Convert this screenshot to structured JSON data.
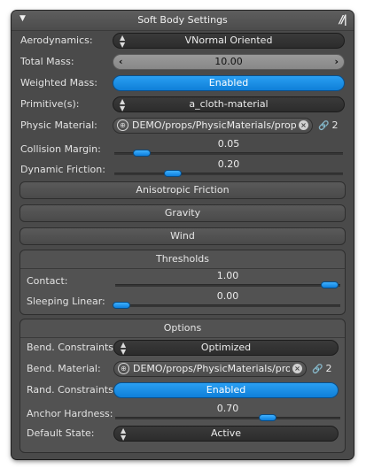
{
  "panel": {
    "title": "Soft Body Settings"
  },
  "rows": {
    "aerodynamics": {
      "label": "Aerodynamics:",
      "value": "VNormal Oriented"
    },
    "total_mass": {
      "label": "Total Mass:",
      "value": "10.00"
    },
    "weighted_mass": {
      "label": "Weighted Mass:",
      "value": "Enabled"
    },
    "primitives": {
      "label": "Primitive(s):",
      "value": "a_cloth-material"
    },
    "physic_material": {
      "label": "Physic Material:",
      "value": "DEMO/props/PhysicMaterials/prop_cl",
      "count": "2"
    },
    "collision_margin": {
      "label": "Collision Margin:",
      "value": "0.05",
      "level": 0.05
    },
    "dynamic_friction": {
      "label": "Dynamic Friction:",
      "value": "0.20",
      "level": 0.2
    }
  },
  "sections": {
    "anisotropic": "Anisotropic Friction",
    "gravity": "Gravity",
    "wind": "Wind"
  },
  "thresholds": {
    "title": "Thresholds",
    "contact": {
      "label": "Contact:",
      "value": "1.00",
      "level": 1.0
    },
    "sleeping_linear": {
      "label": "Sleeping Linear:",
      "value": "0.00",
      "level": 0.0
    }
  },
  "options": {
    "title": "Options",
    "bend_constraints": {
      "label": "Bend. Constraints:",
      "value": "Optimized"
    },
    "bend_material": {
      "label": "Bend. Material:",
      "value": "DEMO/props/PhysicMaterials/prop_",
      "count": "2"
    },
    "rand_constraints": {
      "label": "Rand. Constraints:",
      "value": "Enabled"
    },
    "anchor_hardness": {
      "label": "Anchor Hardness:",
      "value": "0.70",
      "level": 0.7
    },
    "default_state": {
      "label": "Default State:",
      "value": "Active"
    }
  },
  "colors": {
    "accent": "#1a8fe8",
    "panel": "#4a4a4a",
    "field": "#2f2f2f"
  },
  "icons": {
    "collapse": "triangle-down-icon",
    "grip": "grip-icon",
    "spinner": "up-down-arrows-icon",
    "globe": "globe-icon",
    "clear": "clear-icon",
    "link": "link-chain-icon"
  }
}
